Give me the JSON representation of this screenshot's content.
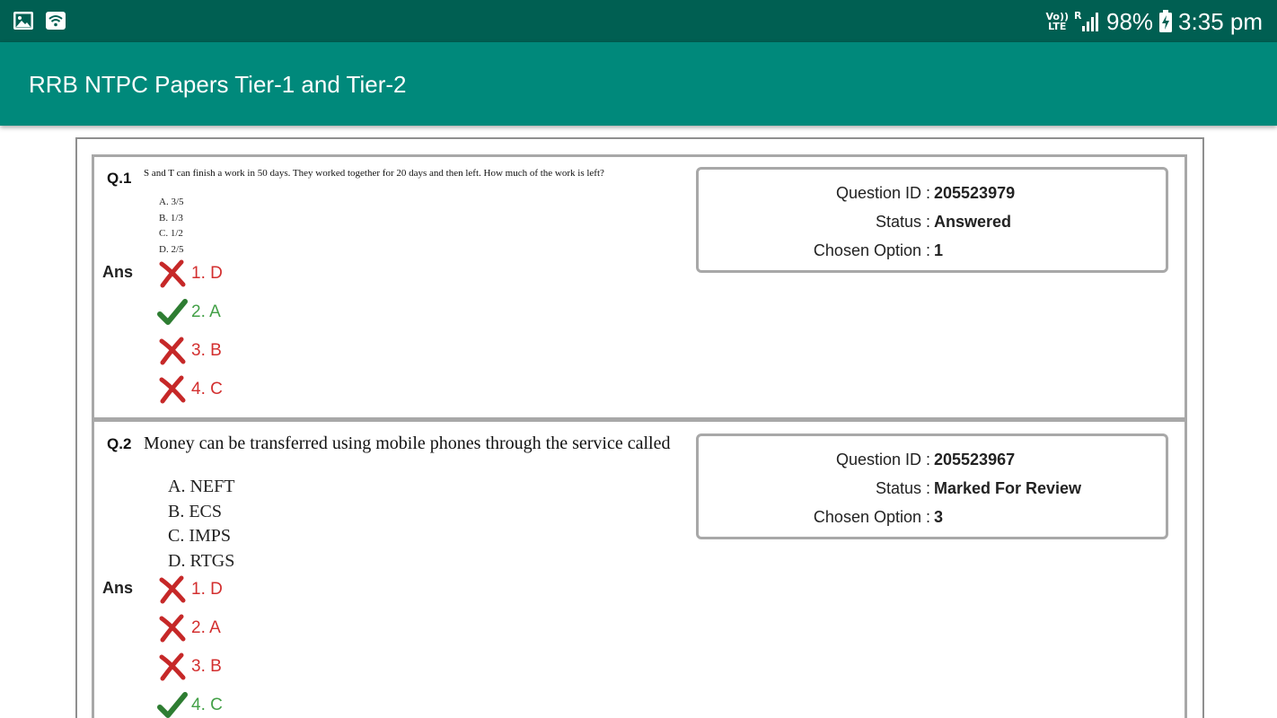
{
  "status_bar": {
    "icons_left": [
      "gallery-icon",
      "wifi-icon"
    ],
    "volte_line1": "Vo))",
    "volte_line2": "LTE",
    "roaming": "R",
    "battery_percent": "98%",
    "time": "3:35 pm"
  },
  "app_bar": {
    "title": "RRB NTPC Papers Tier-1 and Tier-2",
    "color": "#00897b"
  },
  "questions": [
    {
      "number": "Q.1",
      "text": "S and T can finish a work in 50 days. They worked together for 20 days and then left. How much of the work is left?",
      "options": [
        "A. 3/5",
        "B. 1/3",
        "C. 1/2",
        "D. 2/5"
      ],
      "ans_label": "Ans",
      "answers": [
        {
          "text": "1. D",
          "correct": false
        },
        {
          "text": "2. A",
          "correct": true
        },
        {
          "text": "3. B",
          "correct": false
        },
        {
          "text": "4. C",
          "correct": false
        }
      ],
      "info": {
        "question_id_label": "Question ID :",
        "question_id": "205523979",
        "status_label": "Status :",
        "status": "Answered",
        "chosen_label": "Chosen Option :",
        "chosen": "1"
      }
    },
    {
      "number": "Q.2",
      "text": "Money can be transferred using mobile phones through the service called",
      "options": [
        "A. NEFT",
        "B. ECS",
        "C. IMPS",
        "D. RTGS"
      ],
      "ans_label": "Ans",
      "answers": [
        {
          "text": "1. D",
          "correct": false
        },
        {
          "text": "2. A",
          "correct": false
        },
        {
          "text": "3. B",
          "correct": false
        },
        {
          "text": "4. C",
          "correct": true
        }
      ],
      "info": {
        "question_id_label": "Question ID :",
        "question_id": "205523967",
        "status_label": "Status :",
        "status": "Marked For Review",
        "chosen_label": "Chosen Option :",
        "chosen": "3"
      }
    }
  ],
  "colors": {
    "status_bar": "#005f52",
    "wrong": "#d32f2f",
    "correct": "#43a047"
  }
}
